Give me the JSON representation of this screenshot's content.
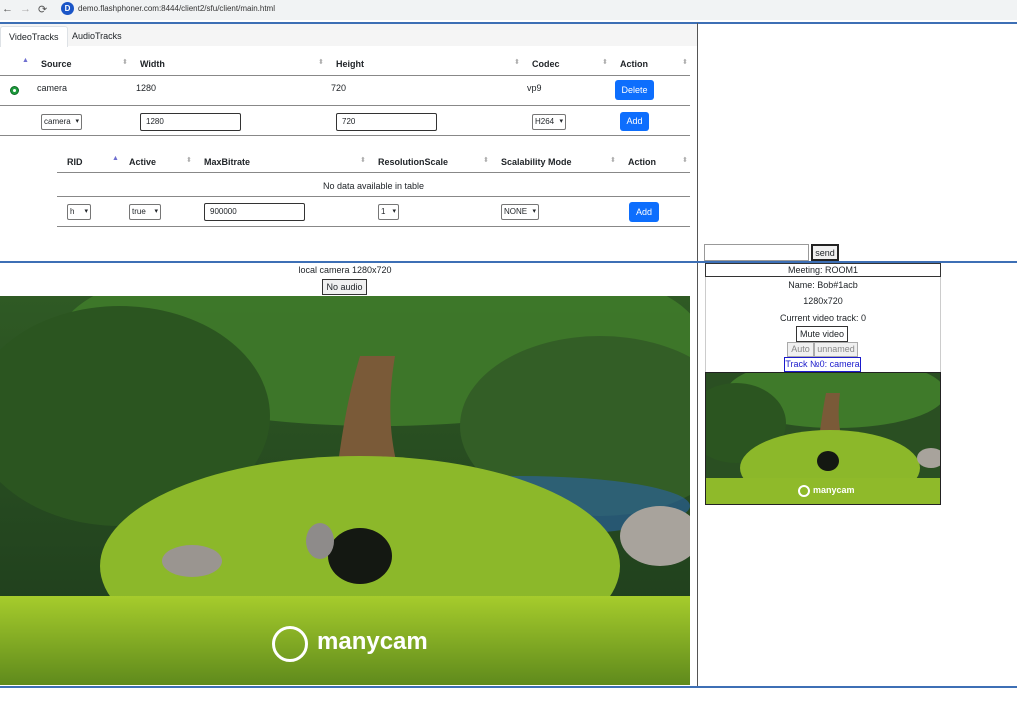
{
  "browser": {
    "url_host": "demo.flashphoner.com",
    "url_path": ":8444/client2/sfu/client/main.html",
    "favicon_letter": "D"
  },
  "tabs": [
    "VideoTracks",
    "AudioTracks"
  ],
  "video_tracks": {
    "headers": [
      "Source",
      "Width",
      "Height",
      "Codec",
      "Action"
    ],
    "row": {
      "source": "camera",
      "width": "1280",
      "height": "720",
      "codec": "vp9",
      "action": "Delete"
    },
    "add_form": {
      "source": "camera",
      "width": "1280",
      "height": "720",
      "codec": "H264",
      "action": "Add"
    }
  },
  "encodings": {
    "headers": [
      "RID",
      "Active",
      "MaxBitrate",
      "ResolutionScale",
      "Scalability Mode",
      "Action"
    ],
    "empty_text": "No data available in table",
    "add_form": {
      "rid": "h",
      "active": "true",
      "max_bitrate": "900000",
      "resolution_scale": "1",
      "scalability_mode": "NONE",
      "action": "Add"
    }
  },
  "chat": {
    "input_value": "",
    "send_label": "send"
  },
  "local_video": {
    "label": "local camera 1280x720",
    "audio_button": "No audio",
    "watermark": "manycam"
  },
  "remote": {
    "meeting": "Meeting: ROOM1",
    "name": "Name: Bob#1acb",
    "resolution": "1280x720",
    "current_track": "Current video track: 0",
    "mute_button": "Mute video",
    "quality_auto": "Auto",
    "quality_unnamed": "unnamed",
    "track_button": "Track №0: camera",
    "watermark": "manycam"
  },
  "colors": {
    "accent": "#0d6efd",
    "divider": "#3d6fb5",
    "status": "#1e9c3d",
    "track_link": "#1a1acc"
  }
}
